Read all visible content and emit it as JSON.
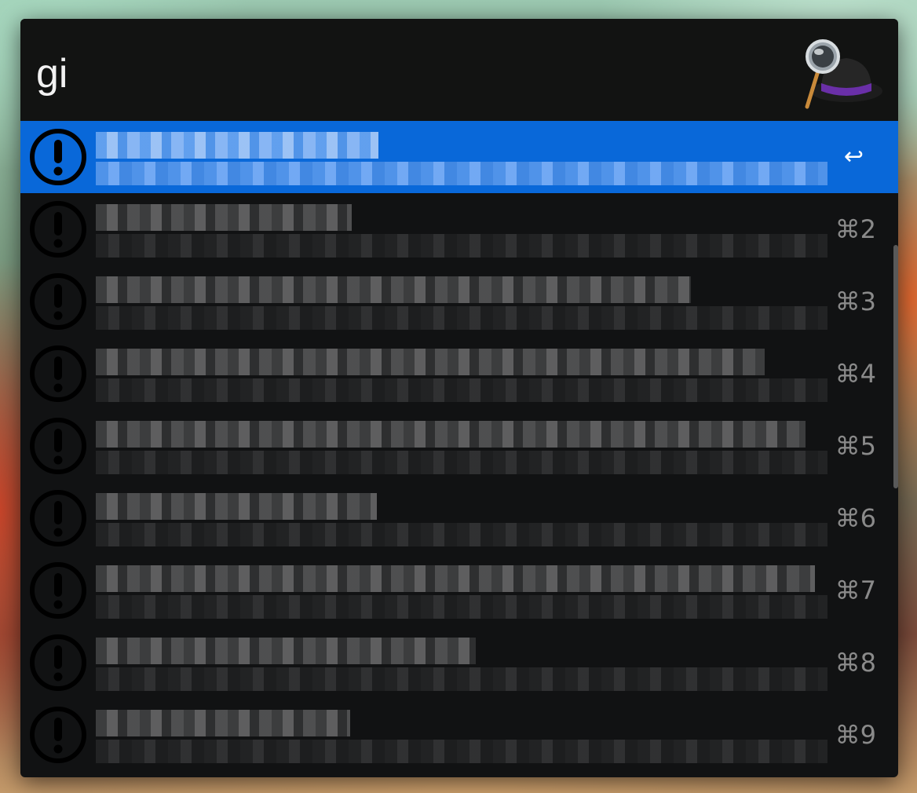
{
  "search": {
    "query": "gi"
  },
  "app": {
    "logo": "alfred-hat-magnifier-icon"
  },
  "results": [
    {
      "shortcut": "↩",
      "selected": true,
      "icon": "exclamation-circle-icon"
    },
    {
      "shortcut": "⌘2",
      "selected": false,
      "icon": "exclamation-circle-icon"
    },
    {
      "shortcut": "⌘3",
      "selected": false,
      "icon": "exclamation-circle-icon"
    },
    {
      "shortcut": "⌘4",
      "selected": false,
      "icon": "exclamation-circle-icon"
    },
    {
      "shortcut": "⌘5",
      "selected": false,
      "icon": "exclamation-circle-icon"
    },
    {
      "shortcut": "⌘6",
      "selected": false,
      "icon": "exclamation-circle-icon"
    },
    {
      "shortcut": "⌘7",
      "selected": false,
      "icon": "exclamation-circle-icon"
    },
    {
      "shortcut": "⌘8",
      "selected": false,
      "icon": "exclamation-circle-icon"
    },
    {
      "shortcut": "⌘9",
      "selected": false,
      "icon": "exclamation-circle-icon"
    }
  ],
  "colors": {
    "selection": "#0968d9",
    "window": "#111213",
    "shortcut_text": "#8a8a8a"
  }
}
